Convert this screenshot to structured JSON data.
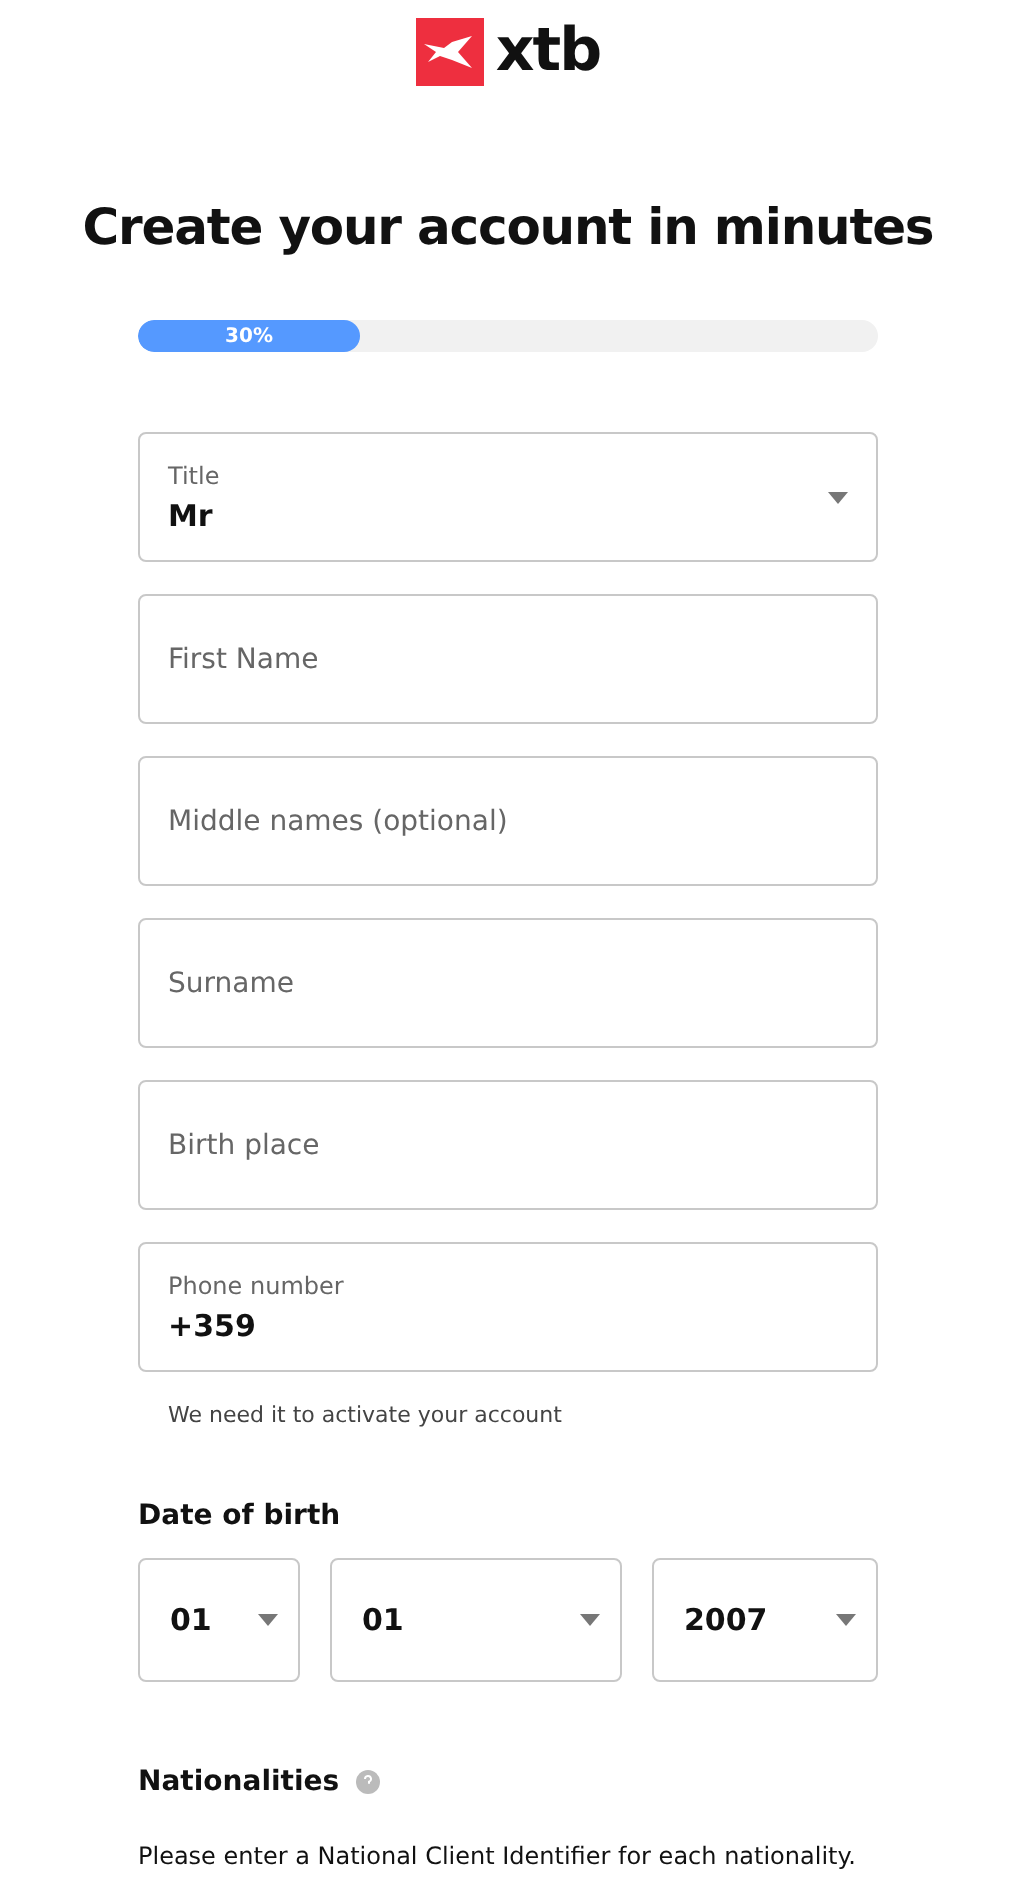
{
  "logo": {
    "text": "xtb"
  },
  "heading": "Create your account in minutes",
  "progress": {
    "level": 0.3,
    "reading": "30%"
  },
  "fields": [
    {
      "kind": "select",
      "label": "Title",
      "value": "Mr"
    },
    {
      "kind": "text",
      "placeholder": "First Name"
    },
    {
      "kind": "text",
      "placeholder": "Middle names (optional)"
    },
    {
      "kind": "text",
      "placeholder": "Surname"
    },
    {
      "kind": "text",
      "placeholder": "Birth place"
    },
    {
      "kind": "labeled",
      "label": "Phone number",
      "value": "+359",
      "hint": "We need it to activate your account"
    }
  ],
  "date_of_birth": {
    "label": "Date of birth",
    "selects": [
      {
        "value": "01"
      },
      {
        "value": "01"
      },
      {
        "value": "2007"
      }
    ]
  },
  "nationalities": {
    "label": "Nationalities",
    "text": "Please enter a National Client Identifier for each nationality."
  }
}
